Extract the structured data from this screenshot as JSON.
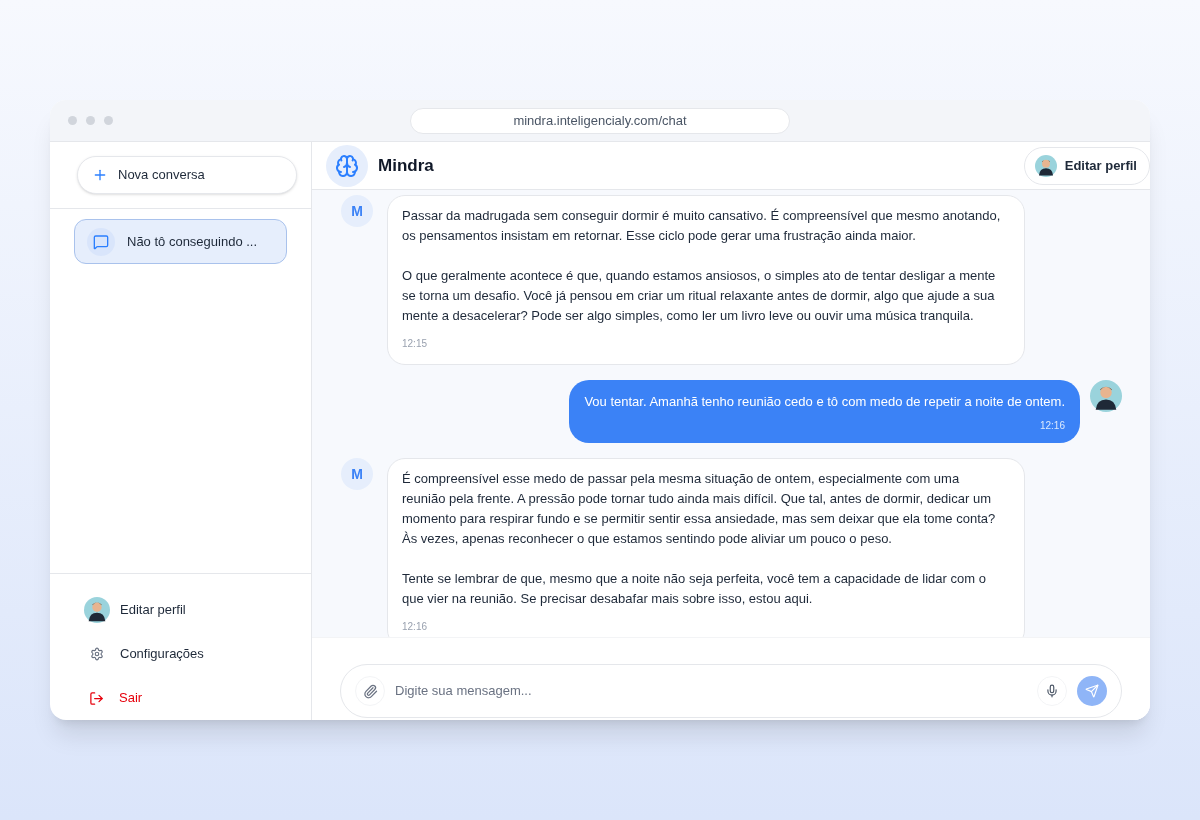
{
  "browser": {
    "url": "mindra.inteligencialy.com/chat"
  },
  "sidebar": {
    "new_chat": "Nova conversa",
    "conversations": [
      {
        "title": "Não tô conseguindo ...",
        "selected": true
      }
    ],
    "footer": [
      {
        "kind": "profile",
        "label": "Editar perfil"
      },
      {
        "kind": "settings",
        "label": "Configurações"
      },
      {
        "kind": "logout",
        "label": "Sair"
      }
    ]
  },
  "header": {
    "title": "Mindra",
    "profile_button": "Editar perfil"
  },
  "messages": [
    {
      "kind": "assistant",
      "avatar": "M",
      "paragraphs": [
        "Passar da madrugada sem conseguir dormir é muito cansativo. É compreensível que mesmo anotando, os pensamentos insistam em retornar. Esse ciclo pode gerar uma frustração ainda maior.",
        "O que geralmente acontece é que, quando estamos ansiosos, o simples ato de tentar desligar a mente se torna um desafio. Você já pensou em criar um ritual relaxante antes de dormir, algo que ajude a sua mente a desacelerar? Pode ser algo simples, como ler um livro leve ou ouvir uma música tranquila."
      ],
      "time": "12:15"
    },
    {
      "kind": "user",
      "paragraphs": [
        "Vou tentar. Amanhã tenho reunião cedo e tô com medo de repetir a noite de ontem."
      ],
      "time": "12:16"
    },
    {
      "kind": "assistant",
      "avatar": "M",
      "paragraphs": [
        "É compreensível esse medo de passar pela mesma situação de ontem, especialmente com uma reunião pela frente. A pressão pode tornar tudo ainda mais difícil. Que tal, antes de dormir, dedicar um momento para respirar fundo e se permitir sentir essa ansiedade, mas sem deixar que ela tome conta? Às vezes, apenas reconhecer o que estamos sentindo pode aliviar um pouco o peso.",
        "Tente se lembrar de que, mesmo que a noite não seja perfeita, você tem a capacidade de lidar com o que vier na reunião. Se precisar desabafar mais sobre isso, estou aqui."
      ],
      "time": "12:16"
    }
  ],
  "composer": {
    "placeholder": "Digite sua mensagem..."
  }
}
